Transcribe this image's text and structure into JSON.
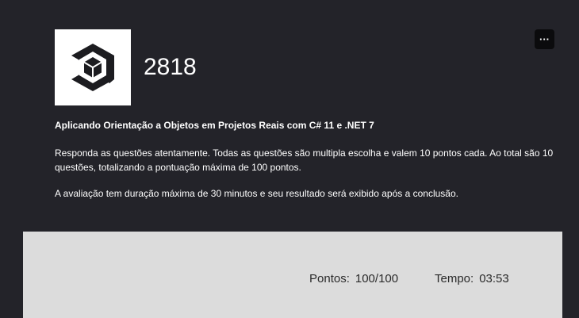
{
  "header": {
    "course_code": "2818",
    "menu_label": "···"
  },
  "course": {
    "title": "Aplicando Orientação a Objetos em Projetos Reais com C# 11 e .NET 7",
    "instructions": "Responda as questões atentamente. Todas as questões são multipla escolha e valem 10 pontos cada. Ao total são 10 questões, totalizando a pontuação máxima de 100 pontos.",
    "duration_note": "A avaliação tem duração máxima de 30 minutos e seu resultado será exibido após a conclusão."
  },
  "result": {
    "points_label": "Pontos:",
    "points_value": "100/100",
    "time_label": "Tempo:",
    "time_value": "03:53"
  },
  "colors": {
    "background": "#232329",
    "panel": "#dcdcdc",
    "logo_bg": "#ffffff",
    "menu_bg": "#0b0b0d"
  },
  "icons": {
    "logo": "cube-logo-icon",
    "menu": "ellipsis-icon"
  }
}
